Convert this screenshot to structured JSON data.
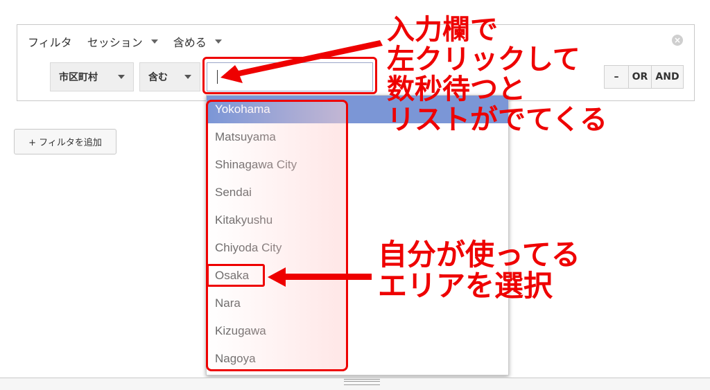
{
  "filter": {
    "label": "フィルタ",
    "session": "セッション",
    "include": "含める",
    "dimension": "市区町村",
    "match": "含む",
    "input_value": ""
  },
  "operators": {
    "minus": "–",
    "or": "OR",
    "and": "AND"
  },
  "add_filter": "+ フィルタを追加",
  "dropdown": {
    "items": [
      "Yokohama",
      "Matsuyama",
      "Shinagawa City",
      "Sendai",
      "Kitakyushu",
      "Chiyoda City",
      "Osaka",
      "Nara",
      "Kizugawa",
      "Nagoya"
    ],
    "active": "Yokohama"
  },
  "annotations": {
    "top": [
      "入力欄で",
      "左クリックして",
      "数秒待つと",
      "リストがでてくる"
    ],
    "bottom": [
      "自分が使ってる",
      "エリアを選択"
    ]
  },
  "colors": {
    "annotation": "#ee0000",
    "active_item": "#7b96d6"
  },
  "icons": [
    "close-icon",
    "caret-down-icon",
    "grip-icon"
  ]
}
